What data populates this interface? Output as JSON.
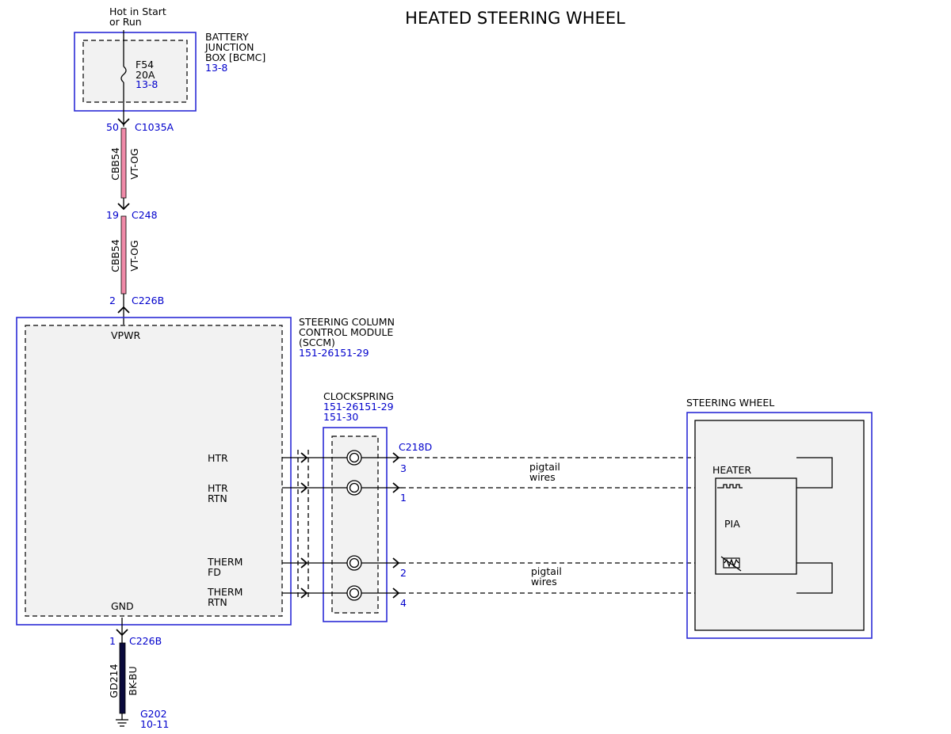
{
  "title": "HEATED STEERING WHEEL",
  "colors": {
    "module_outline": "#2b2bd6",
    "reference_text": "#0000cc",
    "wire_vt_og": "#f08aa8",
    "wire_bk_bu": "#0a0a3c",
    "module_fill": "#f2f2f2"
  },
  "power_source": {
    "line1": "Hot in Start",
    "line2": "or Run"
  },
  "battery_junction_box": {
    "name_lines": [
      "BATTERY",
      "JUNCTION",
      "BOX [BCMC]"
    ],
    "ref": "13-8",
    "fuse": {
      "id": "F54",
      "rating": "20A",
      "ref": "13-8"
    }
  },
  "connectors": {
    "c1035a": {
      "pin": "50",
      "id": "C1035A"
    },
    "c248": {
      "pin": "19",
      "id": "C248"
    },
    "c226b_power": {
      "pin": "2",
      "id": "C226B"
    },
    "c226b_ground": {
      "pin": "1",
      "id": "C226B"
    },
    "c218d": {
      "id": "C218D",
      "pins": [
        "3",
        "1",
        "2",
        "4"
      ]
    }
  },
  "wires": {
    "upper": {
      "circuit": "CBB54",
      "color": "VT-OG"
    },
    "middle": {
      "circuit": "CBB54",
      "color": "VT-OG"
    },
    "ground": {
      "circuit": "GD214",
      "color": "BK-BU"
    }
  },
  "sccm": {
    "name_lines": [
      "STEERING COLUMN",
      "CONTROL MODULE",
      "(SCCM)"
    ],
    "ref": "151-26151-29",
    "vpwr": "VPWR",
    "gnd": "GND",
    "pins": [
      [
        "HTR"
      ],
      [
        "HTR",
        "RTN"
      ],
      [
        "THERM",
        "FD"
      ],
      [
        "THERM",
        "RTN"
      ]
    ]
  },
  "clockspring": {
    "name": "CLOCKSPRING",
    "refs": [
      "151-26151-29",
      "151-30"
    ]
  },
  "pigtail_label": [
    "pigtail",
    "wires"
  ],
  "steering_wheel": {
    "name": "STEERING WHEEL",
    "heater": "HEATER",
    "pia": "PIA"
  },
  "ground_point": {
    "id": "G202",
    "ref": "10-11"
  }
}
